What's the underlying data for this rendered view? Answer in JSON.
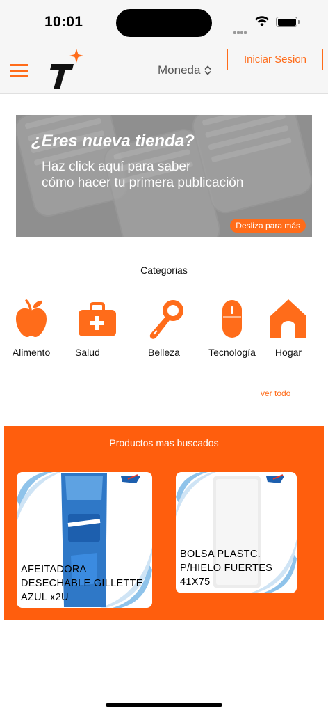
{
  "status": {
    "time": "10:01"
  },
  "header": {
    "currency_label": "Moneda",
    "login_label": "Iniciar Sesion"
  },
  "banner": {
    "title": "¿Eres nueva tienda?",
    "line1": "Haz click aquí para saber",
    "line2": "cómo hacer tu primera publicación",
    "pill": "Desliza para más"
  },
  "categories": {
    "title": "Categorias",
    "items": [
      {
        "label": "Alimento",
        "icon": "apple-icon"
      },
      {
        "label": "Salud",
        "icon": "medical-kit-icon"
      },
      {
        "label": "Belleza",
        "icon": "hair-dryer-icon"
      },
      {
        "label": "Tecnología",
        "icon": "mouse-icon"
      },
      {
        "label": "Hogar",
        "icon": "house-icon"
      }
    ],
    "see_all": "ver todo"
  },
  "products": {
    "title": "Productos mas buscados",
    "items": [
      {
        "name_lines": [
          "AFEITADORA",
          "DESECHABLE GILLETTE",
          "AZUL x2U"
        ]
      },
      {
        "name_lines": [
          "BOLSA PLASTC.",
          "P/HIELO FUERTES",
          "41X75"
        ]
      }
    ]
  },
  "colors": {
    "accent": "#ff6c1a",
    "products_bg": "#ff5e0d"
  }
}
